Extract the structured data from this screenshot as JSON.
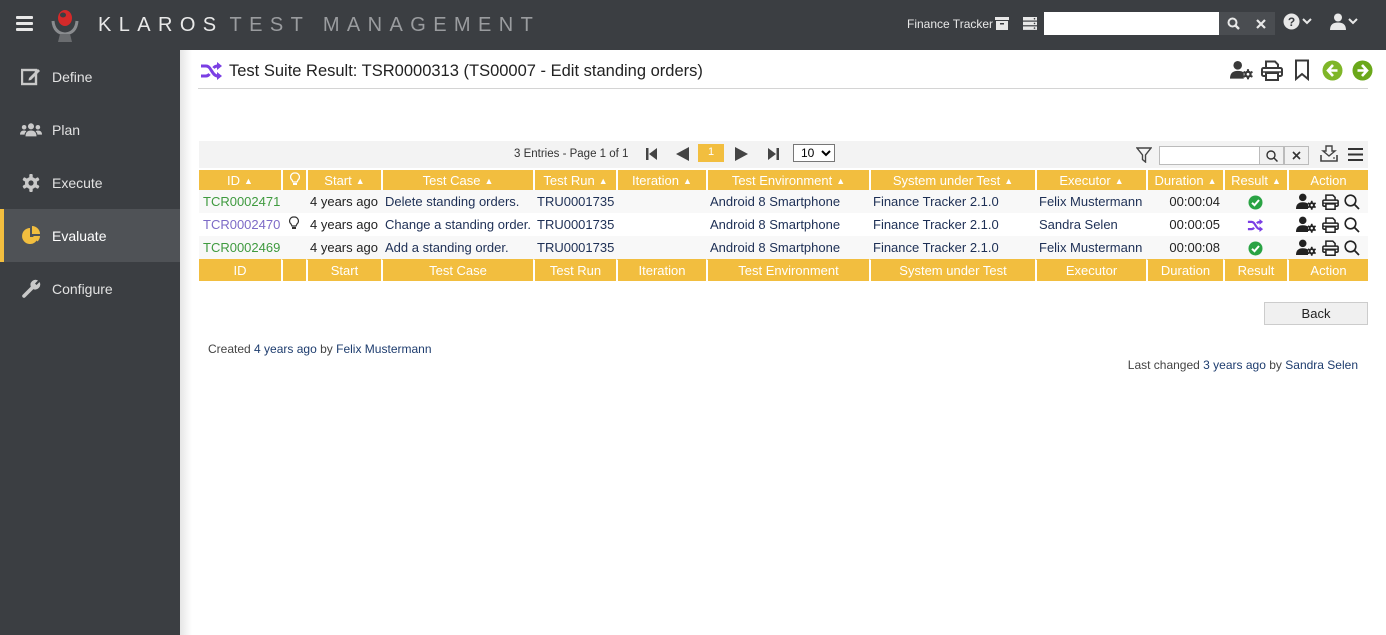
{
  "app": {
    "brand_primary": "KLAROS",
    "brand_secondary": "TEST MANAGEMENT",
    "project_name": "Finance Tracker",
    "search_value": "",
    "colors": {
      "accent": "#f2be3f",
      "topbar": "#3b3e42",
      "passed": "#2aa344",
      "suite": "#7b3fe4",
      "link": "#1d3c6e",
      "nav_green": "#7fb628"
    }
  },
  "sidebar": {
    "items": [
      {
        "label": "Define",
        "icon": "edit-icon"
      },
      {
        "label": "Plan",
        "icon": "users-icon"
      },
      {
        "label": "Execute",
        "icon": "gear-icon"
      },
      {
        "label": "Evaluate",
        "icon": "pie-chart-icon",
        "active": true
      },
      {
        "label": "Configure",
        "icon": "wrench-icon"
      }
    ]
  },
  "page": {
    "title": "Test Suite Result: TSR0000313 (TS00007 - Edit standing orders)"
  },
  "grid": {
    "entries_info": "3 Entries - Page 1 of 1",
    "current_page": "1",
    "page_size": "10",
    "page_size_options": [
      "10"
    ],
    "filter_value": "",
    "columns": [
      "ID",
      "",
      "Start",
      "Test Case",
      "Test Run",
      "Iteration",
      "Test Environment",
      "System under Test",
      "Executor",
      "Duration",
      "Result",
      "Action"
    ],
    "rows": [
      {
        "id": "TCR0002471",
        "id_color": "#3f9a3f",
        "hint": false,
        "start": "4 years ago",
        "test_case": "Delete standing orders.",
        "test_run": "TRU0001735",
        "iteration": "",
        "environment": "Android 8 Smartphone",
        "sut": "Finance Tracker 2.1.0",
        "executor": "Felix Mustermann",
        "duration": "00:00:04",
        "result": "passed"
      },
      {
        "id": "TCR0002470",
        "id_color": "#7d6bc7",
        "hint": true,
        "start": "4 years ago",
        "test_case": "Change a standing order.",
        "test_run": "TRU0001735",
        "iteration": "",
        "environment": "Android 8 Smartphone",
        "sut": "Finance Tracker 2.1.0",
        "executor": "Sandra Selen",
        "duration": "00:00:05",
        "result": "suite"
      },
      {
        "id": "TCR0002469",
        "id_color": "#3f9a3f",
        "hint": false,
        "start": "4 years ago",
        "test_case": "Add a standing order.",
        "test_run": "TRU0001735",
        "iteration": "",
        "environment": "Android 8 Smartphone",
        "sut": "Finance Tracker 2.1.0",
        "executor": "Felix Mustermann",
        "duration": "00:00:08",
        "result": "passed"
      }
    ]
  },
  "footer": {
    "back_label": "Back",
    "created_prefix": "Created",
    "created_when": "4 years ago",
    "created_by_word": "by",
    "created_by": "Felix Mustermann",
    "changed_prefix": "Last changed",
    "changed_when": "3 years ago",
    "changed_by_word": "by",
    "changed_by": "Sandra Selen"
  }
}
